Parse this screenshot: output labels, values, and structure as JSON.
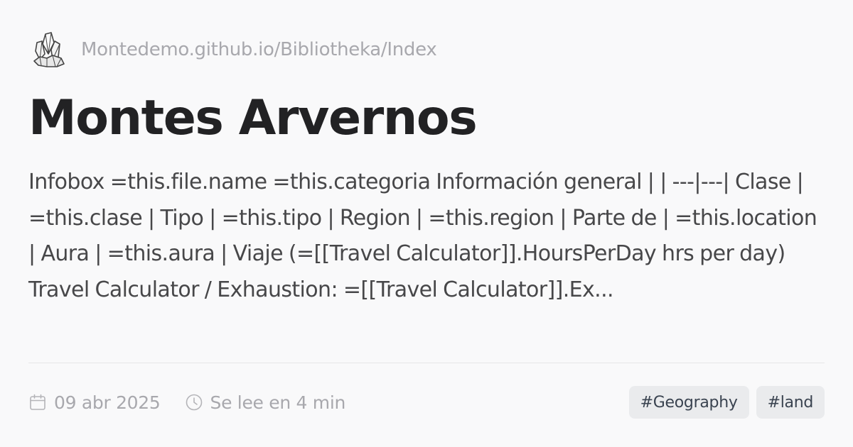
{
  "site": {
    "logo_icon": "crystal-cluster-icon",
    "url": "Montedemo.github.io/Bibliotheka/Index"
  },
  "article": {
    "title": "Montes Arvernos",
    "excerpt": "Infobox =this.file.name =this.categoria Información general | | ---|---| Clase | =this.clase | Tipo | =this.tipo | Region | =this.region | Parte de | =this.location | Aura | =this.aura | Viaje (=[[Travel Calculator]].HoursPerDay hrs per day) Travel Calculator / Exhaustion: =[[Travel Calculator]].Ex..."
  },
  "meta": {
    "date_icon": "calendar-icon",
    "date": "09 abr 2025",
    "reading_icon": "clock-icon",
    "reading_time": "Se lee en 4 min"
  },
  "tags": [
    {
      "label": "#Geography"
    },
    {
      "label": "#land"
    }
  ],
  "colors": {
    "background": "#f9f9fa",
    "title": "#222224",
    "excerpt": "#474749",
    "muted": "#a8a8ad",
    "tag_bg": "#eaebed",
    "tag_text": "#3a4350"
  }
}
